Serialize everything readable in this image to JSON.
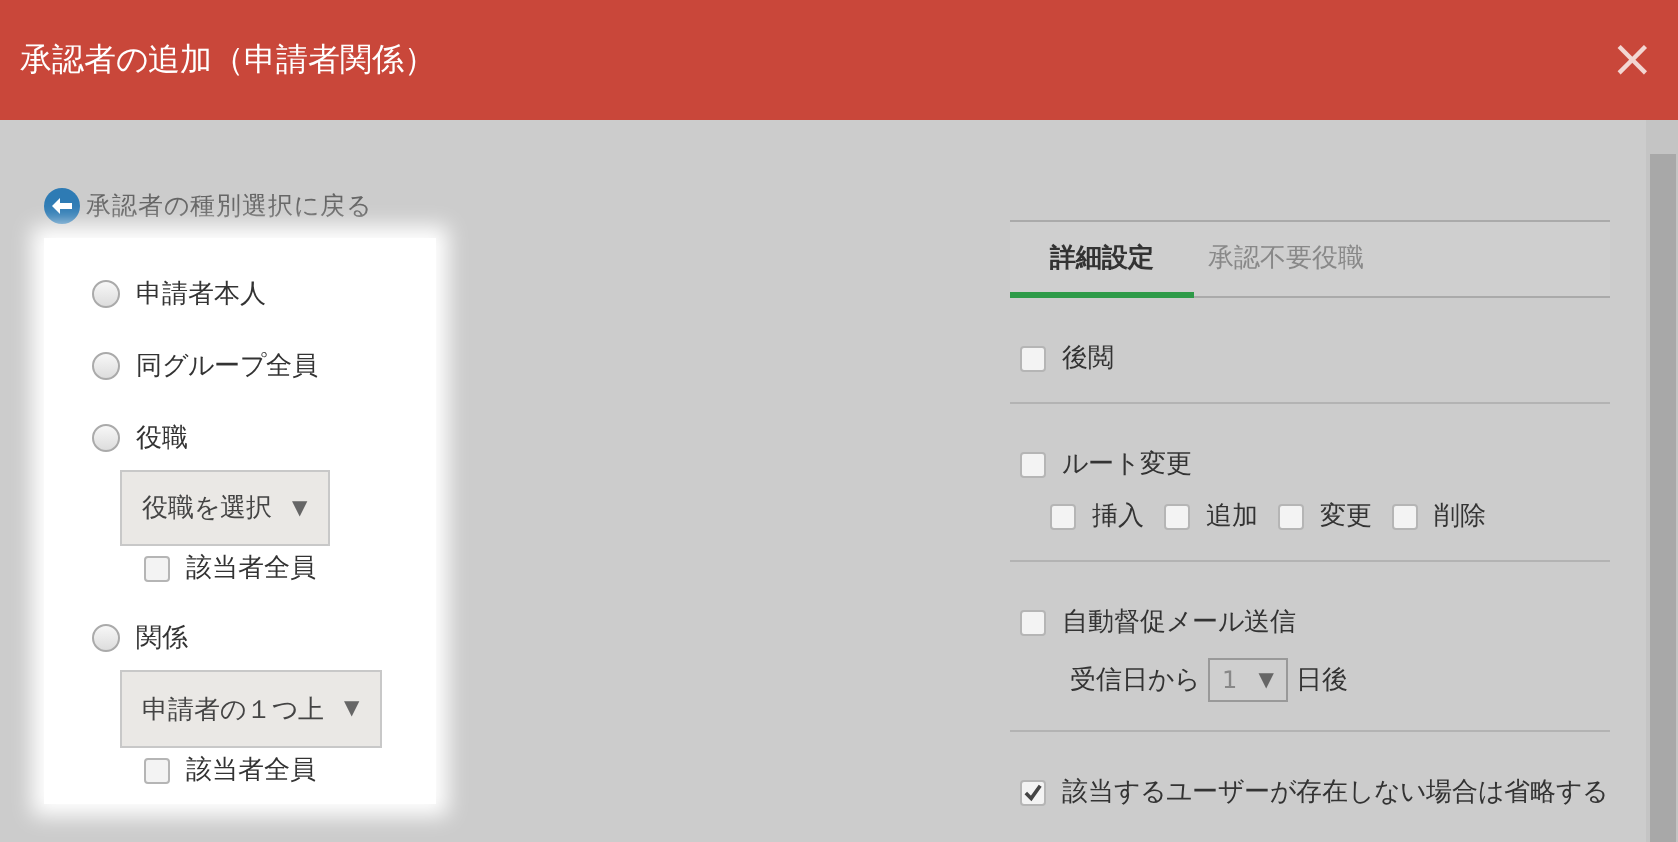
{
  "window": {
    "title": "承認者の追加（申請者関係）",
    "close": "×"
  },
  "back_link": {
    "label": "承認者の種別選択に戻る"
  },
  "options": [
    {
      "kind": "plain",
      "label": "申請者本人",
      "selected": false
    },
    {
      "kind": "plain",
      "label": "同グループ全員",
      "selected": false
    },
    {
      "kind": "select",
      "label": "役職",
      "selected": false,
      "select": {
        "value": "役職を選択",
        "caret": "▼"
      },
      "all": {
        "label": "該当者全員",
        "checked": false
      }
    },
    {
      "kind": "select",
      "label": "関係",
      "selected": false,
      "select": {
        "value": "申請者の１つ上",
        "caret": "▼"
      },
      "all": {
        "label": "該当者全員",
        "checked": false
      }
    }
  ],
  "tabs": [
    {
      "label": "詳細設定",
      "selected": true
    },
    {
      "label": "承認不要役職",
      "selected": false
    }
  ],
  "settings": [
    {
      "kind": "check",
      "label": "後閲",
      "checked": false
    },
    {
      "kind": "route",
      "label": "ルート変更",
      "checked": false,
      "sub": [
        {
          "label": "挿入",
          "checked": false
        },
        {
          "label": "追加",
          "checked": false
        },
        {
          "label": "変更",
          "checked": false
        },
        {
          "label": "削除",
          "checked": false
        }
      ]
    },
    {
      "kind": "reminder",
      "label": "自動督促メール送信",
      "checked": false,
      "prefix": "受信日から",
      "value": "1",
      "caret": "▼",
      "suffix": "日後"
    },
    {
      "kind": "check",
      "label": "該当するユーザーが存在しない場合は省略する",
      "checked": true
    }
  ]
}
